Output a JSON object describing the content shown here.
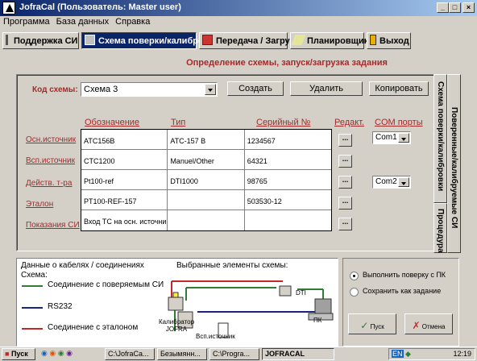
{
  "window": {
    "title": "JofraCal (Пользователь: Master user)"
  },
  "menu": [
    "Программа",
    "База данных",
    "Справка"
  ],
  "toolbar": {
    "tabs": [
      {
        "label": "Поддержка СИ"
      },
      {
        "label": "Схема поверки/калибровки"
      },
      {
        "label": "Передача / Загрузка"
      },
      {
        "label": "Планировщик"
      },
      {
        "label": "Выход"
      }
    ]
  },
  "heading": "Определение схемы, запуск/загрузка задания",
  "scheme": {
    "code_label": "Код схемы:",
    "code_value": "Схема 3",
    "create_label": "Создать",
    "delete_label": "Удалить",
    "copy_label": "Копировать"
  },
  "table": {
    "headers": {
      "designation": "Обозначение",
      "type": "Тип",
      "serial": "Серийный №",
      "edit": "Редакт.",
      "com": "COM порты"
    },
    "rows": [
      {
        "label": "Осн.источник",
        "designation": "ATC156B",
        "type": "ATC-157 B",
        "serial": "1234567",
        "com": "Com1"
      },
      {
        "label": "Всп.источник",
        "designation": "CTC1200",
        "type": "Manuel/Other",
        "serial": "64321",
        "com": ""
      },
      {
        "label": "Действ. т-ра",
        "designation": "Pt100-ref",
        "type": "DTI1000",
        "serial": "98765",
        "com": "Com2"
      },
      {
        "label": "Эталон",
        "designation": "PT100-REF-157",
        "type": "",
        "serial": "503530-12",
        "com": ""
      },
      {
        "label": "Показания СИ",
        "designation": "Вход ТС на осн. источнике",
        "type": "",
        "serial": "",
        "com": ""
      }
    ],
    "edit_button_label": "..."
  },
  "side_tabs": {
    "scheme": "Схема поверки/калибровки",
    "procedure": "Процедура",
    "calibrated": "Поверенные/калибруемые СИ"
  },
  "cables": {
    "title": "Данные о кабелях / соединениях",
    "scheme_label": "Схема:",
    "legend": [
      {
        "label": "Соединение с поверяемым СИ",
        "color": "#2e7d32"
      },
      {
        "label": "RS232",
        "color": "#1a237e"
      },
      {
        "label": "Соединение с эталоном",
        "color": "#c62828"
      }
    ],
    "selected_title": "Выбранные элементы схемы:",
    "nodes": {
      "dti": "DTI",
      "pc": "ПК",
      "calibrator": "Калибратор\nJOFRA",
      "aux": "Всп.источник"
    }
  },
  "options": {
    "run_label": "Выполнить поверку с ПК",
    "save_label": "Сохранить как задание",
    "ok_label": "Пуск",
    "cancel_label": "Отмена"
  },
  "taskbar": {
    "start_label": "Пуск",
    "items": [
      "C:\\JofraCa...",
      "Безымянн...",
      "C:\\Progra...",
      "JOFRACAL"
    ],
    "lang": "EN",
    "clock": "12:19"
  },
  "colors": {
    "title_bar": "#0a246a",
    "accent_red": "#a52a2a"
  }
}
